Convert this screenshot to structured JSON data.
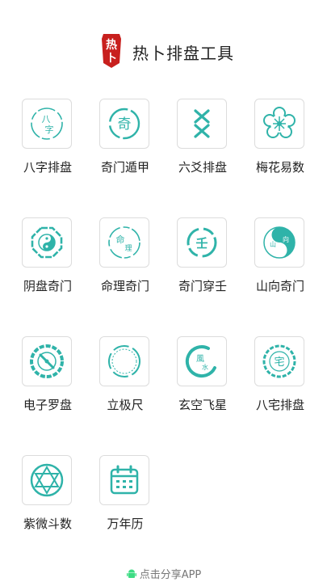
{
  "header": {
    "logo_text": "热卜",
    "title": "热卜排盘工具"
  },
  "accent_color": "#2fb3a9",
  "tools": [
    {
      "label": "八字排盘",
      "icon": "bazi-icon",
      "glyph": "八字"
    },
    {
      "label": "奇门遁甲",
      "icon": "qimen-icon",
      "glyph": "奇"
    },
    {
      "label": "六爻排盘",
      "icon": "liuyao-icon",
      "glyph": ""
    },
    {
      "label": "梅花易数",
      "icon": "plum-blossom-icon",
      "glyph": ""
    },
    {
      "label": "阴盘奇门",
      "icon": "yinyang-bagua-icon",
      "glyph": ""
    },
    {
      "label": "命理奇门",
      "icon": "mingli-icon",
      "glyph": "命理"
    },
    {
      "label": "奇门穿壬",
      "icon": "ren-icon",
      "glyph": "壬"
    },
    {
      "label": "山向奇门",
      "icon": "shan-xiang-icon",
      "glyph": "山向"
    },
    {
      "label": "电子罗盘",
      "icon": "compass-icon",
      "glyph": ""
    },
    {
      "label": "立极尺",
      "icon": "ruler-ring-icon",
      "glyph": ""
    },
    {
      "label": "玄空飞星",
      "icon": "fengshui-icon",
      "glyph": "風水"
    },
    {
      "label": "八宅排盘",
      "icon": "zhai-icon",
      "glyph": "宅"
    },
    {
      "label": "紫微斗数",
      "icon": "hexagram-icon",
      "glyph": ""
    },
    {
      "label": "万年历",
      "icon": "calendar-icon",
      "glyph": ""
    }
  ],
  "footer": {
    "share_label": "点击分享APP",
    "icon": "android-icon"
  }
}
